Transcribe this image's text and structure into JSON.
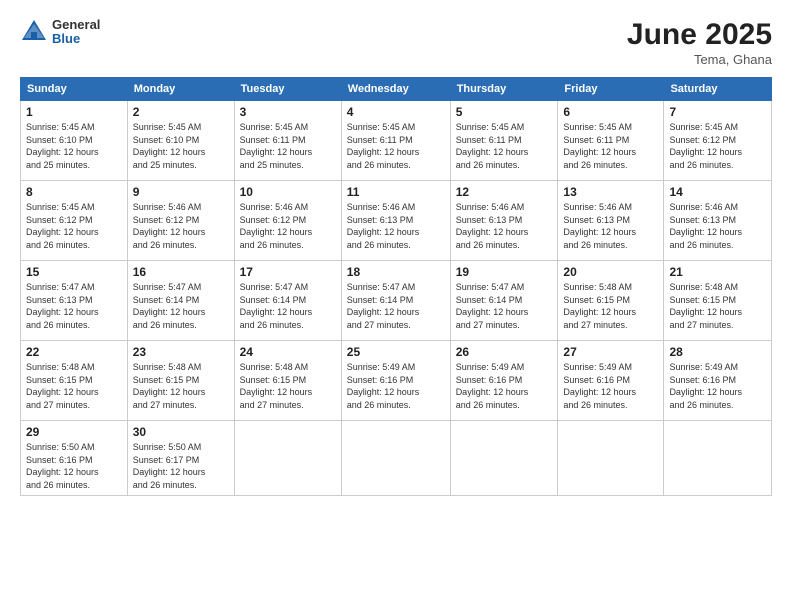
{
  "header": {
    "logo_general": "General",
    "logo_blue": "Blue",
    "month_year": "June 2025",
    "location": "Tema, Ghana"
  },
  "days_of_week": [
    "Sunday",
    "Monday",
    "Tuesday",
    "Wednesday",
    "Thursday",
    "Friday",
    "Saturday"
  ],
  "weeks": [
    [
      {
        "day": "1",
        "info": "Sunrise: 5:45 AM\nSunset: 6:10 PM\nDaylight: 12 hours\nand 25 minutes."
      },
      {
        "day": "2",
        "info": "Sunrise: 5:45 AM\nSunset: 6:10 PM\nDaylight: 12 hours\nand 25 minutes."
      },
      {
        "day": "3",
        "info": "Sunrise: 5:45 AM\nSunset: 6:11 PM\nDaylight: 12 hours\nand 25 minutes."
      },
      {
        "day": "4",
        "info": "Sunrise: 5:45 AM\nSunset: 6:11 PM\nDaylight: 12 hours\nand 26 minutes."
      },
      {
        "day": "5",
        "info": "Sunrise: 5:45 AM\nSunset: 6:11 PM\nDaylight: 12 hours\nand 26 minutes."
      },
      {
        "day": "6",
        "info": "Sunrise: 5:45 AM\nSunset: 6:11 PM\nDaylight: 12 hours\nand 26 minutes."
      },
      {
        "day": "7",
        "info": "Sunrise: 5:45 AM\nSunset: 6:12 PM\nDaylight: 12 hours\nand 26 minutes."
      }
    ],
    [
      {
        "day": "8",
        "info": "Sunrise: 5:45 AM\nSunset: 6:12 PM\nDaylight: 12 hours\nand 26 minutes."
      },
      {
        "day": "9",
        "info": "Sunrise: 5:46 AM\nSunset: 6:12 PM\nDaylight: 12 hours\nand 26 minutes."
      },
      {
        "day": "10",
        "info": "Sunrise: 5:46 AM\nSunset: 6:12 PM\nDaylight: 12 hours\nand 26 minutes."
      },
      {
        "day": "11",
        "info": "Sunrise: 5:46 AM\nSunset: 6:13 PM\nDaylight: 12 hours\nand 26 minutes."
      },
      {
        "day": "12",
        "info": "Sunrise: 5:46 AM\nSunset: 6:13 PM\nDaylight: 12 hours\nand 26 minutes."
      },
      {
        "day": "13",
        "info": "Sunrise: 5:46 AM\nSunset: 6:13 PM\nDaylight: 12 hours\nand 26 minutes."
      },
      {
        "day": "14",
        "info": "Sunrise: 5:46 AM\nSunset: 6:13 PM\nDaylight: 12 hours\nand 26 minutes."
      }
    ],
    [
      {
        "day": "15",
        "info": "Sunrise: 5:47 AM\nSunset: 6:13 PM\nDaylight: 12 hours\nand 26 minutes."
      },
      {
        "day": "16",
        "info": "Sunrise: 5:47 AM\nSunset: 6:14 PM\nDaylight: 12 hours\nand 26 minutes."
      },
      {
        "day": "17",
        "info": "Sunrise: 5:47 AM\nSunset: 6:14 PM\nDaylight: 12 hours\nand 26 minutes."
      },
      {
        "day": "18",
        "info": "Sunrise: 5:47 AM\nSunset: 6:14 PM\nDaylight: 12 hours\nand 27 minutes."
      },
      {
        "day": "19",
        "info": "Sunrise: 5:47 AM\nSunset: 6:14 PM\nDaylight: 12 hours\nand 27 minutes."
      },
      {
        "day": "20",
        "info": "Sunrise: 5:48 AM\nSunset: 6:15 PM\nDaylight: 12 hours\nand 27 minutes."
      },
      {
        "day": "21",
        "info": "Sunrise: 5:48 AM\nSunset: 6:15 PM\nDaylight: 12 hours\nand 27 minutes."
      }
    ],
    [
      {
        "day": "22",
        "info": "Sunrise: 5:48 AM\nSunset: 6:15 PM\nDaylight: 12 hours\nand 27 minutes."
      },
      {
        "day": "23",
        "info": "Sunrise: 5:48 AM\nSunset: 6:15 PM\nDaylight: 12 hours\nand 27 minutes."
      },
      {
        "day": "24",
        "info": "Sunrise: 5:48 AM\nSunset: 6:15 PM\nDaylight: 12 hours\nand 27 minutes."
      },
      {
        "day": "25",
        "info": "Sunrise: 5:49 AM\nSunset: 6:16 PM\nDaylight: 12 hours\nand 26 minutes."
      },
      {
        "day": "26",
        "info": "Sunrise: 5:49 AM\nSunset: 6:16 PM\nDaylight: 12 hours\nand 26 minutes."
      },
      {
        "day": "27",
        "info": "Sunrise: 5:49 AM\nSunset: 6:16 PM\nDaylight: 12 hours\nand 26 minutes."
      },
      {
        "day": "28",
        "info": "Sunrise: 5:49 AM\nSunset: 6:16 PM\nDaylight: 12 hours\nand 26 minutes."
      }
    ],
    [
      {
        "day": "29",
        "info": "Sunrise: 5:50 AM\nSunset: 6:16 PM\nDaylight: 12 hours\nand 26 minutes."
      },
      {
        "day": "30",
        "info": "Sunrise: 5:50 AM\nSunset: 6:17 PM\nDaylight: 12 hours\nand 26 minutes."
      },
      null,
      null,
      null,
      null,
      null
    ]
  ]
}
